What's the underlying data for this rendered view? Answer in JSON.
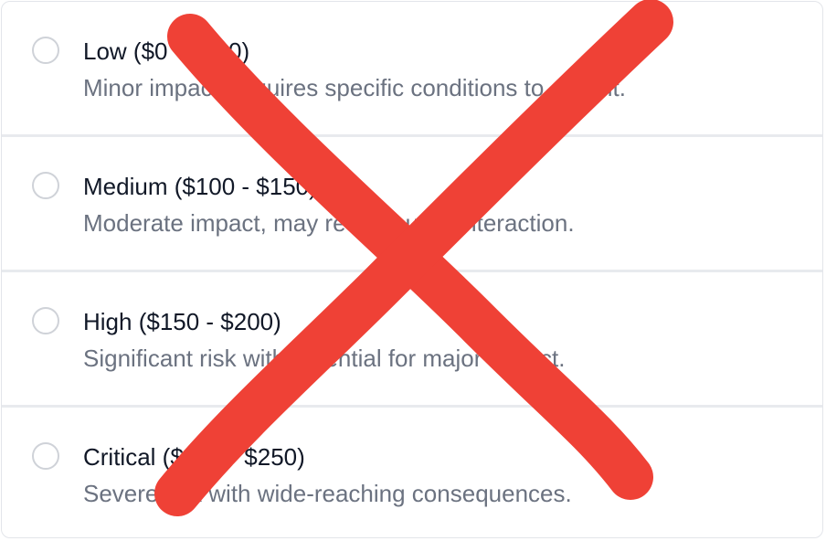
{
  "options": [
    {
      "title": "Low ($0 - $100)",
      "description": "Minor impact, requires specific conditions to exploit."
    },
    {
      "title": "Medium ($100 - $150)",
      "description": "Moderate impact, may require user interaction."
    },
    {
      "title": "High ($150 - $200)",
      "description": "Significant risk with potential for major impact."
    },
    {
      "title": "Critical ($200 - $250)",
      "description": "Severe risk with wide-reaching consequences."
    }
  ],
  "overlay": {
    "icon": "cross-out-mark",
    "color": "#ef4136"
  }
}
